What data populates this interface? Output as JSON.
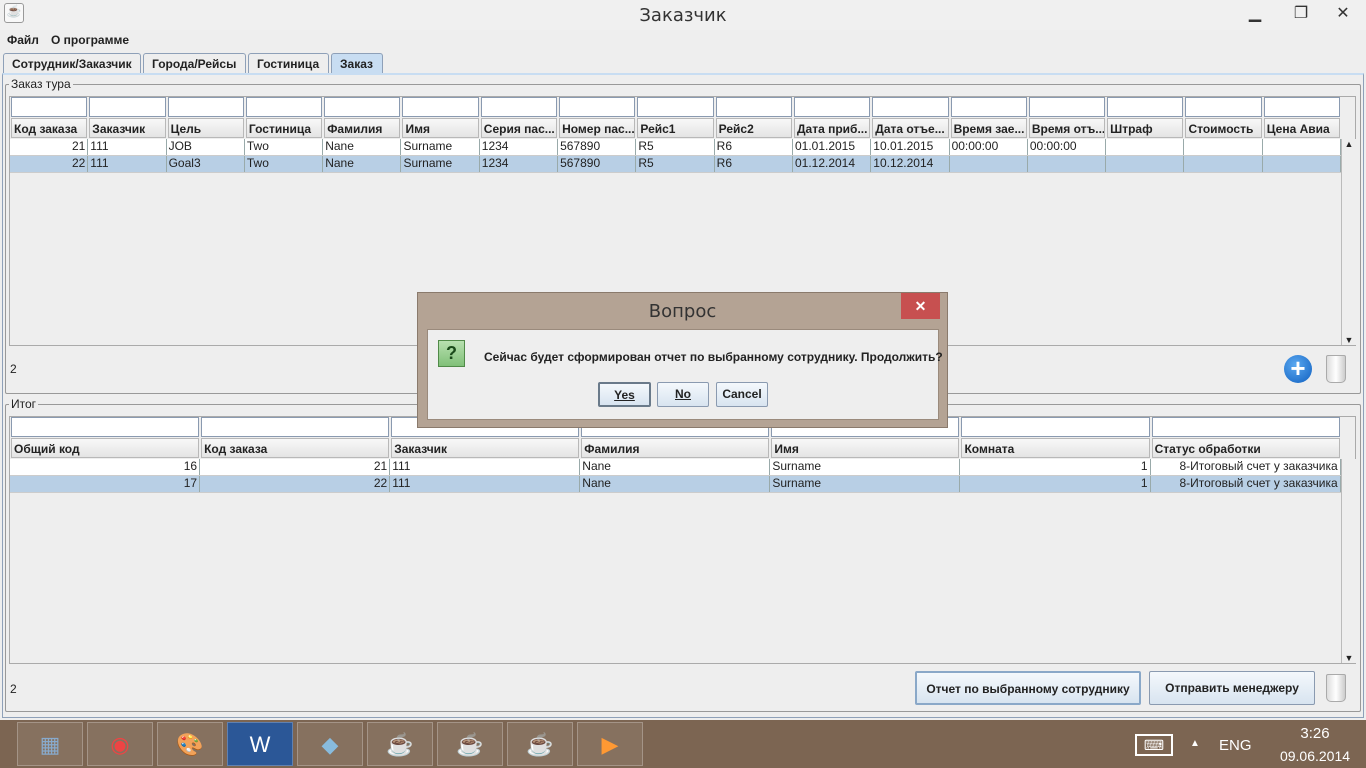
{
  "window": {
    "title": "Заказчик",
    "minimize": "▁",
    "maximize": "❐",
    "close": "✕"
  },
  "menu": [
    "Файл",
    "О программе"
  ],
  "tabs": [
    "Сотрудник/Заказчик",
    "Города/Рейсы",
    "Гостиница",
    "Заказ"
  ],
  "order": {
    "group_label": "Заказ тура",
    "columns": [
      "Код заказа",
      "Заказчик",
      "Цель",
      "Гостиница",
      "Фамилия",
      "Имя",
      "Серия пас...",
      "Номер пас...",
      "Рейс1",
      "Рейс2",
      "Дата приб...",
      "Дата отъе...",
      "Время зае...",
      "Время отъ...",
      "Штраф",
      "Стоимость",
      "Цена Авиа"
    ],
    "rows": [
      [
        "21",
        "111",
        "JOB",
        "Two",
        "Nane",
        "Surname",
        "1234",
        "567890",
        "R5",
        "R6",
        "01.01.2015",
        "10.01.2015",
        "00:00:00",
        "00:00:00",
        "",
        "",
        ""
      ],
      [
        "22",
        "111",
        "Goal3",
        "Two",
        "Nane",
        "Surname",
        "1234",
        "567890",
        "R5",
        "R6",
        "01.12.2014",
        "10.12.2014",
        "",
        "",
        "",
        "",
        ""
      ]
    ],
    "count": "2"
  },
  "total": {
    "group_label": "Итог",
    "columns": [
      "Общий код",
      "Код заказа",
      "Заказчик",
      "Фамилия",
      "Имя",
      "Комната",
      "Статус обработки"
    ],
    "rows": [
      [
        "16",
        "21",
        "111",
        "Nane",
        "Surname",
        "1",
        "8-Итоговый счет у заказчика"
      ],
      [
        "17",
        "22",
        "111",
        "Nane",
        "Surname",
        "1",
        "8-Итоговый счет у заказчика"
      ]
    ],
    "count": "2",
    "report_button": "Отчет по выбранному сотруднику",
    "send_button": "Отправить менеджеру"
  },
  "dialog": {
    "title": "Вопрос",
    "message": "Сейчас будет сформирован отчет по выбранному сотруднику. Продолжить?",
    "yes": "Yes",
    "no": "No",
    "cancel": "Cancel",
    "close": "✕",
    "icon": "?"
  },
  "taskbar": {
    "lang": "ENG",
    "time": "3:26",
    "date": "09.06.2014"
  }
}
